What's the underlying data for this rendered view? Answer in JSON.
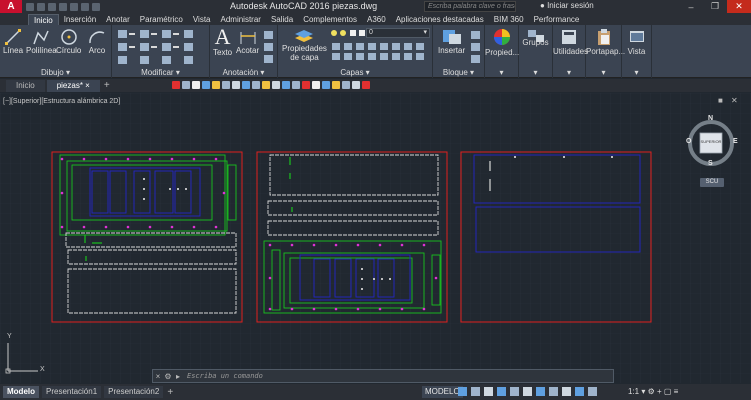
{
  "app": {
    "logo": "A",
    "title": "Autodesk AutoCAD 2016    piezas.dwg",
    "search_placeholder": "Escriba palabra clave o frase",
    "signin_label": "Iniciar sesión"
  },
  "ribbon_tabs": [
    "Inicio",
    "Inserción",
    "Anotar",
    "Paramétrico",
    "Vista",
    "Administrar",
    "Salida",
    "Complementos",
    "A360",
    "Aplicaciones destacadas",
    "BIM 360",
    "Performance"
  ],
  "ribbon": {
    "draw": {
      "line": "Línea",
      "polyline": "Polilínea",
      "circle": "Círculo",
      "arc": "Arco",
      "label": "Dibujo"
    },
    "modify": {
      "label": "Modificar"
    },
    "annotation": {
      "text": "Texto",
      "dimension": "Acotar",
      "label": "Anotación"
    },
    "layers": {
      "properties": "Propiedades",
      "properties2": "de capa",
      "layer_value": "0",
      "label": "Capas"
    },
    "block": {
      "insert": "Insertar",
      "label": "Bloque"
    },
    "properties": {
      "label": "Propied..."
    },
    "groups": {
      "label": "Grupos"
    },
    "utilities": {
      "label": "Utilidades"
    },
    "clipboard": {
      "label": "Portapap..."
    },
    "view": {
      "label": "Vista"
    }
  },
  "file_tabs": [
    {
      "label": "Inicio"
    },
    {
      "label": "piezas*"
    }
  ],
  "viewport": {
    "label": "[−][Superior][Estructura alámbrica 2D]",
    "viewcube": {
      "n": "N",
      "s": "S",
      "e": "E",
      "o": "O",
      "face": "SUPERIOR",
      "wcs": "SCU"
    }
  },
  "command_line": {
    "placeholder": "Escriba un comando"
  },
  "layout_tabs": [
    {
      "label": "Modelo"
    },
    {
      "label": "Presentación1"
    },
    {
      "label": "Presentación2"
    }
  ],
  "status": {
    "model_label": "MODELO",
    "scale": "1:1"
  },
  "colors": {
    "background": "#212830",
    "frame": "#e0201e",
    "piece": "#d8d8d8",
    "green": "#19c21e",
    "blue": "#2326c9",
    "magenta": "#e033d6"
  },
  "ucs": {
    "x": "X",
    "y": "Y"
  }
}
